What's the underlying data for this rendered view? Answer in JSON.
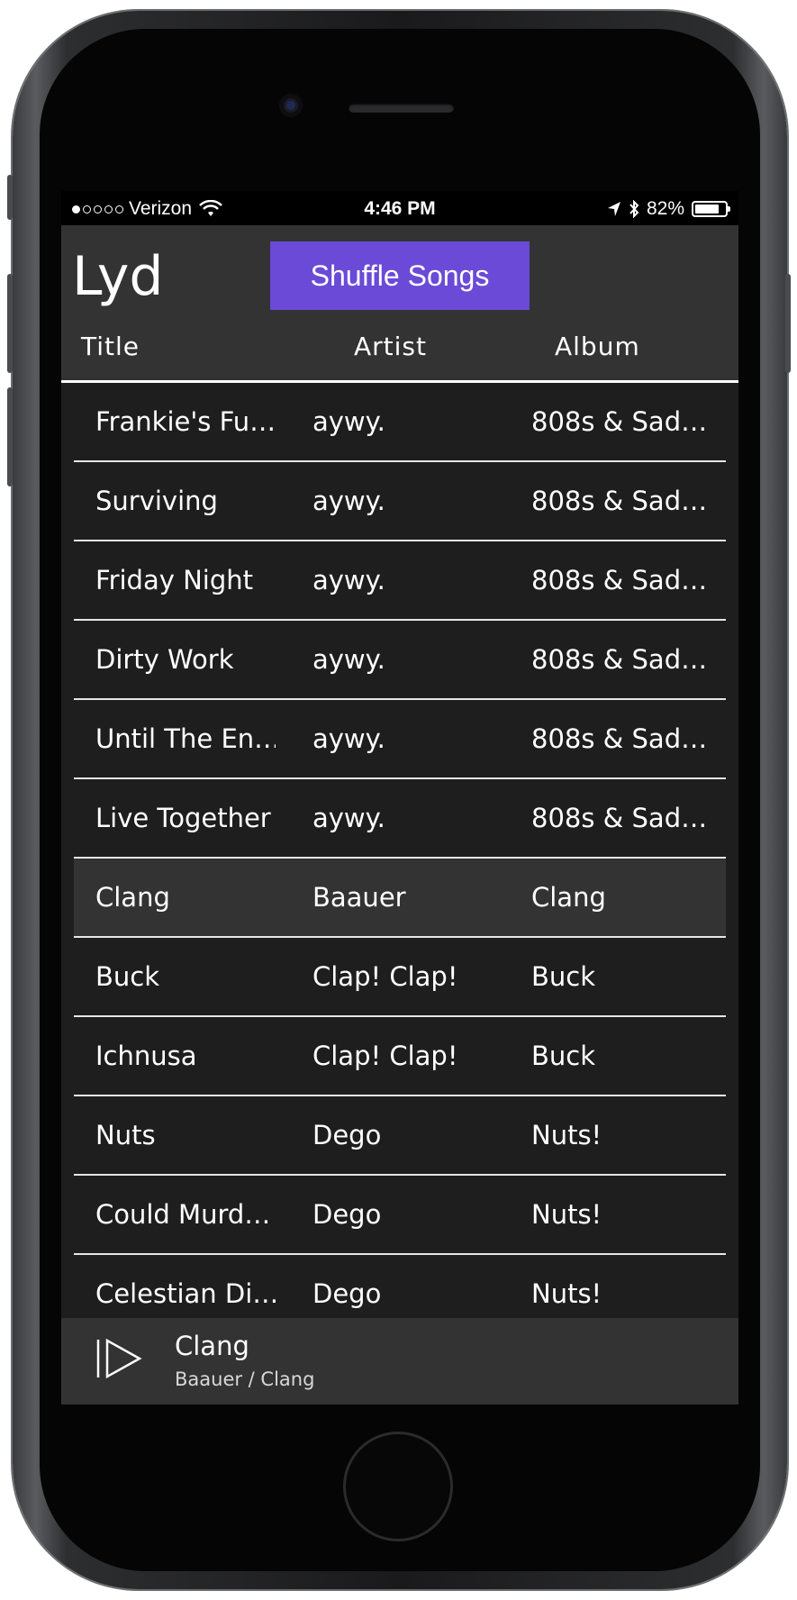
{
  "status_bar": {
    "carrier": "Verizon",
    "signal_bars": 1,
    "time": "4:46 PM",
    "battery_percent": "82%",
    "battery_level": 0.82
  },
  "app": {
    "title": "Lyd",
    "shuffle_label": "Shuffle Songs",
    "accent_color": "#6a4ad6"
  },
  "columns": {
    "title": "Title",
    "artist": "Artist",
    "album": "Album"
  },
  "songs": [
    {
      "title": "Frankie's Fu…",
      "artist": "aywy.",
      "album": "808s & Sad…"
    },
    {
      "title": "Surviving",
      "artist": "aywy.",
      "album": "808s & Sad…"
    },
    {
      "title": "Friday Night",
      "artist": "aywy.",
      "album": "808s & Sad…"
    },
    {
      "title": "Dirty Work",
      "artist": "aywy.",
      "album": "808s & Sad…"
    },
    {
      "title": "Until The En…",
      "artist": "aywy.",
      "album": "808s & Sad…"
    },
    {
      "title": "Live Together",
      "artist": "aywy.",
      "album": "808s & Sad…"
    },
    {
      "title": "Clang",
      "artist": "Baauer",
      "album": "Clang",
      "selected": true
    },
    {
      "title": "Buck",
      "artist": "Clap! Clap!",
      "album": "Buck"
    },
    {
      "title": "Ichnusa",
      "artist": "Clap! Clap!",
      "album": "Buck"
    },
    {
      "title": "Nuts",
      "artist": "Dego",
      "album": "Nuts!"
    },
    {
      "title": "Could Murd…",
      "artist": "Dego",
      "album": "Nuts!"
    },
    {
      "title": "Celestian Di…",
      "artist": "Dego",
      "album": "Nuts!"
    }
  ],
  "now_playing": {
    "title": "Clang",
    "subtitle": "Baauer / Clang",
    "play_icon": "play-icon"
  }
}
